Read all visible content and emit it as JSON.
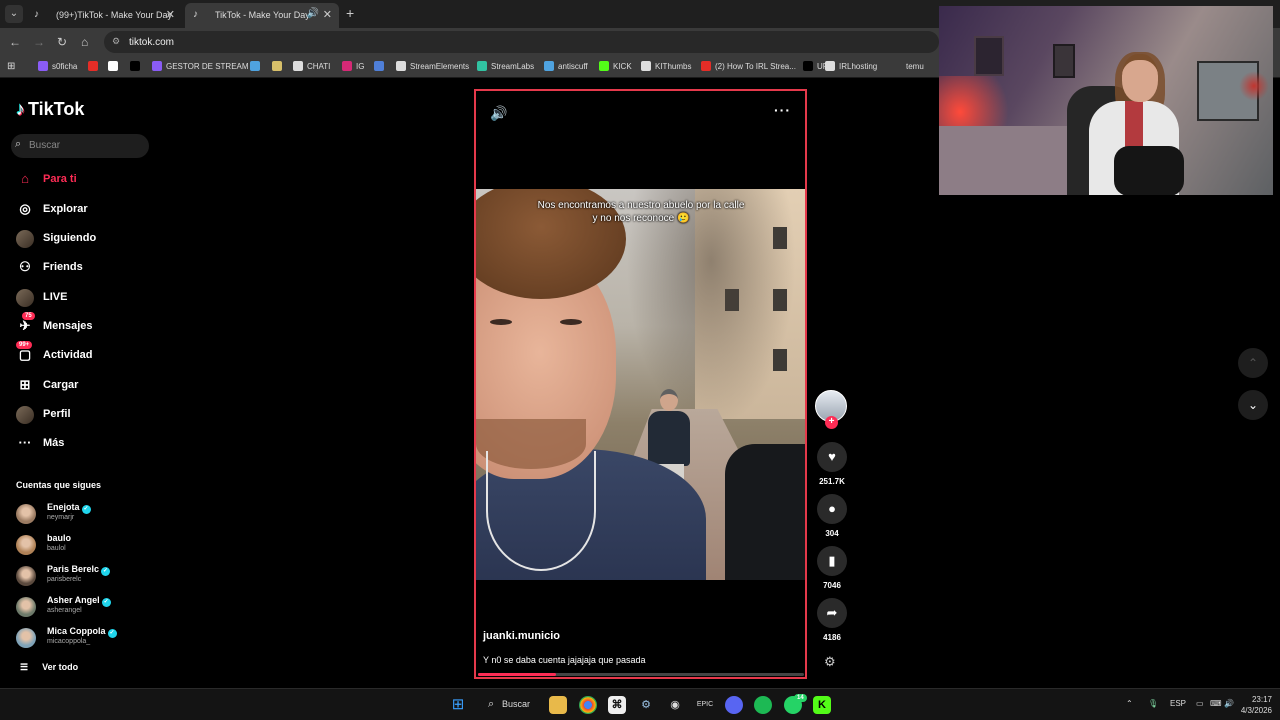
{
  "browser": {
    "tabs": [
      {
        "title": "(99+)TikTok - Make Your Day"
      },
      {
        "title": "TikTok - Make Your Day"
      }
    ],
    "url": "tiktok.com",
    "bookmarks": [
      {
        "label": "s0ficha",
        "color": "#8a5cf6"
      },
      {
        "label": "",
        "color": "#e52d27"
      },
      {
        "label": "",
        "color": "#ffffff"
      },
      {
        "label": "",
        "color": "#000000"
      },
      {
        "label": "GESTOR DE STREAM",
        "color": "#8a5cf6"
      },
      {
        "label": "",
        "color": "#4fa3e0"
      },
      {
        "label": "",
        "color": "#d8c06a"
      },
      {
        "label": "CHATI",
        "color": "#dddddd"
      },
      {
        "label": "IG",
        "color": "#d62976"
      },
      {
        "label": "",
        "color": "#4f7fd8"
      },
      {
        "label": "StreamElements",
        "color": "#dddddd"
      },
      {
        "label": "StreamLabs",
        "color": "#31c3a2"
      },
      {
        "label": "antiscuff",
        "color": "#4fa3e0"
      },
      {
        "label": "KICK",
        "color": "#53fc18"
      },
      {
        "label": "KIThumbs",
        "color": "#dddddd"
      },
      {
        "label": "(2) How To IRL Strea...",
        "color": "#e52d27"
      },
      {
        "label": "UP",
        "color": "#000000"
      },
      {
        "label": "IRLhosting",
        "color": "#dddddd"
      },
      {
        "label": "temu",
        "color": "#3a3a3a"
      }
    ]
  },
  "sidebar": {
    "logo": "TikTok",
    "search_placeholder": "Buscar",
    "nav": [
      {
        "label": "Para ti",
        "icon": "home-icon",
        "glyph": "⌂",
        "active": true
      },
      {
        "label": "Explorar",
        "icon": "compass-icon",
        "glyph": "◎"
      },
      {
        "label": "Siguiendo",
        "icon": "following-avatar-icon",
        "glyph": ""
      },
      {
        "label": "Friends",
        "icon": "friends-icon",
        "glyph": "⚇"
      },
      {
        "label": "LIVE",
        "icon": "live-avatar-icon",
        "glyph": ""
      },
      {
        "label": "Mensajes",
        "icon": "messages-icon",
        "glyph": "✈",
        "badge": "75"
      },
      {
        "label": "Actividad",
        "icon": "activity-icon",
        "glyph": "▢",
        "badge": "99+"
      },
      {
        "label": "Cargar",
        "icon": "upload-icon",
        "glyph": "⊞"
      },
      {
        "label": "Perfil",
        "icon": "profile-avatar-icon",
        "glyph": ""
      },
      {
        "label": "Más",
        "icon": "more-icon",
        "glyph": "···"
      }
    ],
    "following_title": "Cuentas que sigues",
    "following": [
      {
        "name": "Enejota",
        "handle": "neymarjr",
        "verified": true,
        "avatar_color": "#9b7b62"
      },
      {
        "name": "baulo",
        "handle": "baulol",
        "verified": false,
        "avatar_color": "#b08257"
      },
      {
        "name": "Paris Berelc",
        "handle": "parisberelc",
        "verified": true,
        "avatar_color": "#5b4a3e"
      },
      {
        "name": "Asher Angel",
        "handle": "asherangel",
        "verified": true,
        "avatar_color": "#6d7a6a"
      },
      {
        "name": "Mica Coppola",
        "handle": "micacoppola_",
        "verified": true,
        "avatar_color": "#7fa3b8"
      }
    ],
    "see_all": "Ver todo"
  },
  "video": {
    "caption": "Nos encontramos a nuestro abuelo por la calle y no nos reconoce 🥲",
    "creator": "juanki.municio",
    "description": "Y n0 se daba cuenta jajajaja que pasada",
    "progress": 0.24,
    "likes": "251.7K",
    "comments": "304",
    "saves": "7046",
    "shares": "4186"
  },
  "taskbar": {
    "search_label": "Buscar",
    "whatsapp_badge": "14",
    "language": "ESP",
    "time": "23:17",
    "date": "4/3/2026"
  }
}
